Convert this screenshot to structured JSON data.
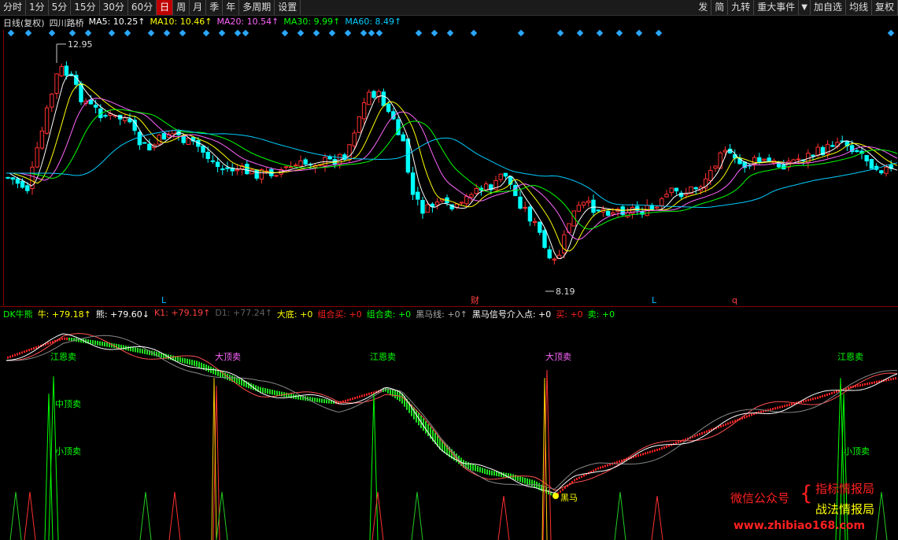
{
  "toolbar": {
    "left": [
      "分时",
      "1分",
      "5分",
      "15分",
      "30分",
      "60分",
      "日",
      "周",
      "月",
      "季",
      "年",
      "多周期",
      "设置"
    ],
    "active": "日",
    "right": [
      "发",
      "简",
      "九转",
      "重大事件",
      "加自选",
      "均线",
      "复权"
    ]
  },
  "ma_line": {
    "period": "日线(复权)",
    "name": "四川路桥",
    "items": [
      {
        "label": "MA5: 10.25↑",
        "color": "#ffffff"
      },
      {
        "label": "MA10: 10.46↑",
        "color": "#ffff00"
      },
      {
        "label": "MA20: 10.54↑",
        "color": "#ff66ff"
      },
      {
        "label": "MA30: 9.99↑",
        "color": "#00ff00"
      },
      {
        "label": "MA60: 8.49↑",
        "color": "#00ccff"
      }
    ]
  },
  "price_labels": {
    "high": "12.95",
    "low": "8.19"
  },
  "markers": [
    {
      "text": "L",
      "color": "#00bfff"
    },
    {
      "text": "财",
      "color": "#ff4040"
    },
    {
      "text": "L",
      "color": "#00bfff"
    },
    {
      "text": "q",
      "color": "#ff4040"
    }
  ],
  "indicator_line": {
    "items": [
      {
        "label": "DK牛熊",
        "color": "#00ff00"
      },
      {
        "label": "牛: +79.18↑",
        "color": "#ffff00"
      },
      {
        "label": "熊: +79.60↓",
        "color": "#ffffff"
      },
      {
        "label": "K1: +79.19↑",
        "color": "#ff4040"
      },
      {
        "label": "D1: +77.24↑",
        "color": "#606060"
      },
      {
        "label": "大底: +0",
        "color": "#ffff00"
      },
      {
        "label": "组合买: +0",
        "color": "#ff2020"
      },
      {
        "label": "组合卖: +0",
        "color": "#00ff00"
      },
      {
        "label": "黑马线: +0↑",
        "color": "#aaaaaa"
      },
      {
        "label": "黑马信号介入点: +0",
        "color": "#ffffff"
      },
      {
        "label": "买: +0",
        "color": "#ff2020"
      },
      {
        "label": "卖: +0",
        "color": "#00ff00"
      }
    ]
  },
  "signals": {
    "jiangen": "江恩卖",
    "dading": "大顶卖",
    "zhongding": "中顶卖",
    "xiaoding": "小顶卖",
    "heima": "黑马"
  },
  "watermark": {
    "line1": "微信公众号",
    "brace": "{",
    "line2": "指标情报局",
    "line3": "战法情报局",
    "url": "www.zhibiao168.com"
  },
  "colors": {
    "up": "#ff3030",
    "down": "#00ffff",
    "accent": "#c00000"
  }
}
